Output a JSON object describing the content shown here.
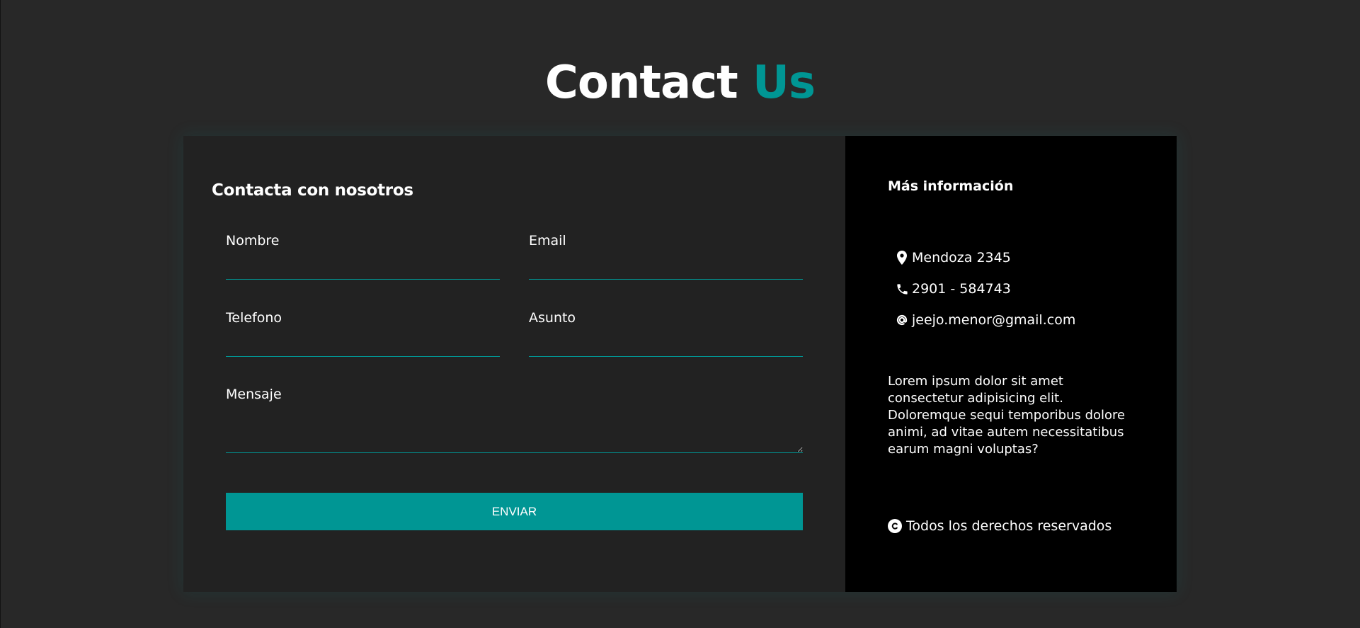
{
  "page": {
    "title_main": "Contact",
    "title_accent": "Us"
  },
  "form": {
    "heading": "Contacta con nosotros",
    "fields": {
      "nombre": {
        "label": "Nombre",
        "value": ""
      },
      "email": {
        "label": "Email",
        "value": ""
      },
      "telefono": {
        "label": "Telefono",
        "value": ""
      },
      "asunto": {
        "label": "Asunto",
        "value": ""
      },
      "mensaje": {
        "label": "Mensaje",
        "value": ""
      }
    },
    "submit_label": "ENVIAR"
  },
  "info": {
    "heading": "Más información",
    "address": "Mendoza 2345",
    "phone": "2901 - 584743",
    "email": "jeejo.menor@gmail.com",
    "description": "Lorem ipsum dolor sit amet consectetur adipisicing elit. Doloremque sequi temporibus dolore animi, ad vitae autem necessitatibus earum magni voluptas?",
    "copyright": "Todos los derechos reservados"
  },
  "icons": {
    "address": "location-pin-icon",
    "phone": "phone-icon",
    "email": "at-sign-icon",
    "copyright": "copyright-icon"
  },
  "colors": {
    "accent": "#009694",
    "background": "#282828",
    "form_panel": "#222222",
    "info_panel": "#000000",
    "text": "#ffffff"
  }
}
